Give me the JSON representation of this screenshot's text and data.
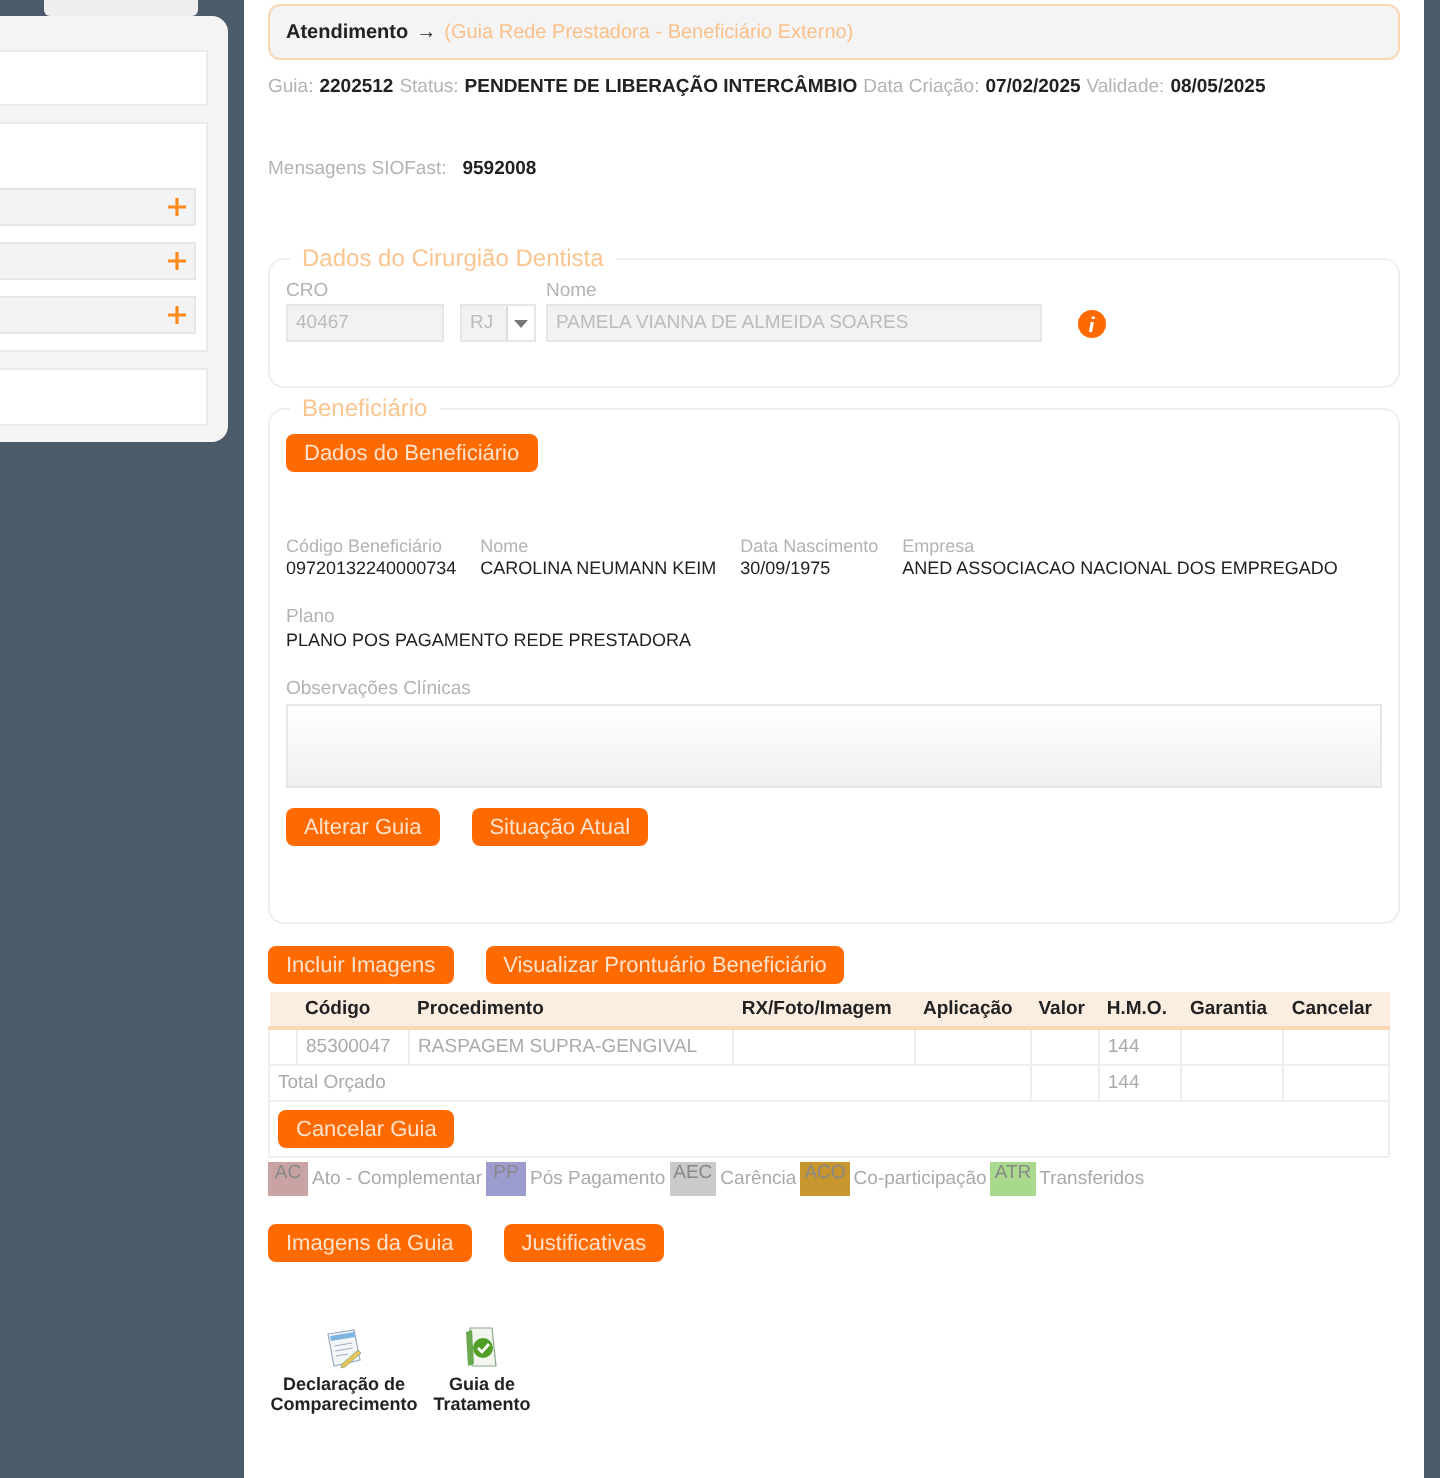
{
  "breadcrumb": {
    "section": "Atendimento",
    "arrow": "→",
    "page": "(Guia Rede Prestadora - Beneficiário Externo)"
  },
  "info": [
    {
      "label": "Guia:",
      "value": "2202512"
    },
    {
      "label": "Status:",
      "value": "PENDENTE DE LIBERAÇÃO INTERCÂMBIO"
    },
    {
      "label": "Data Criação:",
      "value": "07/02/2025"
    },
    {
      "label": "Validade:",
      "value": "08/05/2025"
    }
  ],
  "messages": {
    "label": "Mensagens SIOFast:",
    "value": "9592008"
  },
  "dentist": {
    "title": "Dados do Cirurgião Dentista",
    "cro_label": "CRO",
    "cro": "40467",
    "uf": "RJ",
    "name_label": "Nome",
    "name": "PAMELA VIANNA DE ALMEIDA SOARES"
  },
  "beneficiary": {
    "title": "Beneficiário",
    "button": "Dados do Beneficiário",
    "fields": [
      {
        "label": "Código Beneficiário",
        "value": "09720132240000734"
      },
      {
        "label": "Nome",
        "value": "CAROLINA NEUMANN KEIM"
      },
      {
        "label": "Data Nascimento",
        "value": "30/09/1975"
      },
      {
        "label": "Empresa",
        "value": "ANED ASSOCIACAO NACIONAL DOS EMPREGADO"
      }
    ],
    "plan": {
      "label": "Plano",
      "value": "PLANO POS PAGAMENTO REDE PRESTADORA"
    },
    "notes_label": "Observações Clínicas",
    "buttons": [
      "Alterar Guia",
      "Situação Atual"
    ]
  },
  "top_buttons": [
    "Incluir Imagens",
    "Visualizar Prontuário Beneficiário"
  ],
  "table": {
    "columns": [
      "Código",
      "Procedimento",
      "RX/Foto/Imagem",
      "Aplicação",
      "Valor",
      "H.M.O.",
      "Garantia",
      "Cancelar"
    ],
    "rows": [
      {
        "codigo": "85300047",
        "procedimento": "RASPAGEM SUPRA-GENGIVAL",
        "hmo": "144"
      }
    ],
    "total": {
      "label": "Total Orçado",
      "hmo": "144"
    },
    "cancel_button": "Cancelar Guia"
  },
  "legend": [
    {
      "code": "AC",
      "label": "Ato - Complementar",
      "color": "#c9a3a3"
    },
    {
      "code": "PP",
      "label": "Pós Pagamento",
      "color": "#9c9ccf"
    },
    {
      "code": "AEC",
      "label": "Carência",
      "color": "#cacaca"
    },
    {
      "code": "ACO",
      "label": "Co-participação",
      "color": "#c8962e"
    },
    {
      "code": "ATR",
      "label": "Transferidos",
      "color": "#a9d98c"
    }
  ],
  "bottom_buttons": [
    "Imagens da Guia",
    "Justificativas"
  ],
  "documents": [
    {
      "kind": "declaration",
      "label": "Declaração de Comparecimento"
    },
    {
      "kind": "treatment",
      "label": "Guia de Tratamento"
    }
  ]
}
